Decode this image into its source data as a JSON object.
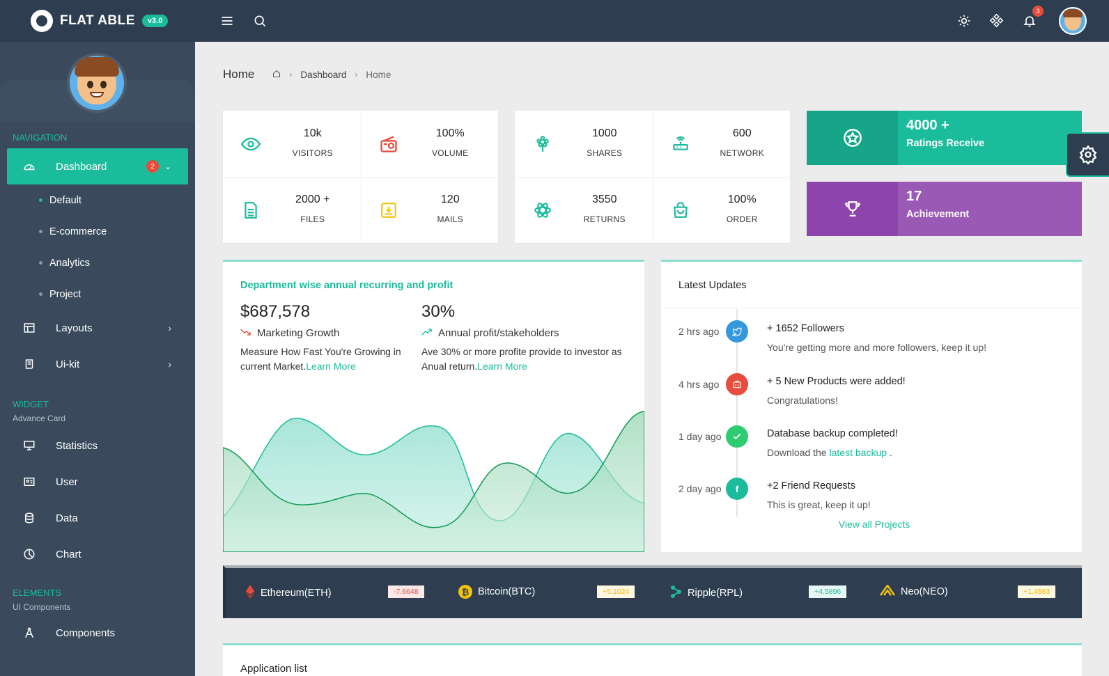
{
  "brand": {
    "name": "FLAT ABLE",
    "version": "v3.0"
  },
  "sidebar": {
    "navigation_caption": "NAVIGATION",
    "dashboard": {
      "label": "Dashboard",
      "badge": "2"
    },
    "dashboard_items": [
      "Default",
      "E-commerce",
      "Analytics",
      "Project"
    ],
    "layouts": "Layouts",
    "uikit": "Ui-kit",
    "widget_caption": "WIDGET",
    "widget_sub": "Advance Card",
    "widget_items": [
      "Statistics",
      "User",
      "Data",
      "Chart"
    ],
    "elements_caption": "ELEMENTS",
    "elements_sub": "UI Components",
    "components": "Components"
  },
  "topbar": {
    "notification_count": "3"
  },
  "breadcrumb": {
    "title": "Home",
    "items": [
      "Dashboard",
      "Home"
    ]
  },
  "stats_left": [
    {
      "value": "10k",
      "label": "VISITORS",
      "icon": "eye-icon",
      "color": "#1abc9c"
    },
    {
      "value": "100%",
      "label": "VOLUME",
      "icon": "radio-icon",
      "color": "#e74c3c"
    },
    {
      "value": "2000 +",
      "label": "FILES",
      "icon": "file-text-icon",
      "color": "#1abc9c"
    },
    {
      "value": "120",
      "label": "MAILS",
      "icon": "inbox-download-icon",
      "color": "#f1c40f"
    }
  ],
  "stats_right": [
    {
      "value": "1000",
      "label": "SHARES",
      "icon": "flower-icon",
      "color": "#1abc9c"
    },
    {
      "value": "600",
      "label": "NETWORK",
      "icon": "router-icon",
      "color": "#1abc9c"
    },
    {
      "value": "3550",
      "label": "RETURNS",
      "icon": "atom-icon",
      "color": "#1abc9c"
    },
    {
      "value": "100%",
      "label": "ORDER",
      "icon": "shopping-bag-icon",
      "color": "#1abc9c"
    }
  ],
  "ratings_card": {
    "value": "4000 +",
    "label": "Ratings Receive",
    "color": "#1abc9c"
  },
  "achievement_card": {
    "value": "17",
    "label": "Achievement",
    "color": "#9b59b6"
  },
  "department": {
    "title": "Department wise annual recurring and profit",
    "col1": {
      "amount": "$687,578",
      "label": "Marketing Growth",
      "desc": "Measure How Fast You're Growing in current Market.",
      "link": "Learn More"
    },
    "col2": {
      "amount": "30%",
      "label": "Annual profit/stakeholders",
      "desc1": "Ave 30% or more profite provide to investor as",
      "desc2": "Anual return.",
      "link": "Learn More"
    }
  },
  "updates": {
    "title": "Latest Updates",
    "items": [
      {
        "time": "2 hrs ago",
        "head": "+ 1652 Followers",
        "body": "You're getting more and more followers, keep it up!",
        "icon": "twitter-icon",
        "color": "#3498db"
      },
      {
        "time": "4 hrs ago",
        "head": "+ 5 New Products were added!",
        "body": "Congratulations!",
        "icon": "briefcase-icon",
        "color": "#e74c3c"
      },
      {
        "time": "1 day ago",
        "head": "Database backup completed!",
        "body": "Download the ",
        "link": "latest backup",
        "body_end": " .",
        "icon": "check-icon",
        "color": "#2ecc71"
      },
      {
        "time": "2 day ago",
        "head": "+2 Friend Requests",
        "body": "This is great, keep it up!",
        "icon": "facebook-icon",
        "color": "#1abc9c"
      }
    ],
    "view_all": "View all Projects"
  },
  "ticker": [
    {
      "name": "Ethereum(ETH)",
      "value": "-7.6648",
      "icon": "ethereum-icon",
      "bg": "#fde8e8",
      "fg": "#e74c3c"
    },
    {
      "name": "Bitcoin(BTC)",
      "value": "+5.1024",
      "icon": "bitcoin-icon",
      "bg": "#fff8e1",
      "fg": "#f1b40f"
    },
    {
      "name": "Ripple(RPL)",
      "value": "+4.5896",
      "icon": "ripple-icon",
      "bg": "#e6f8f4",
      "fg": "#1abc9c"
    },
    {
      "name": "Neo(NEO)",
      "value": "+1.4563",
      "icon": "neo-icon",
      "bg": "#fff8e1",
      "fg": "#f1b40f"
    }
  ],
  "app_list": {
    "title": "Application list"
  }
}
